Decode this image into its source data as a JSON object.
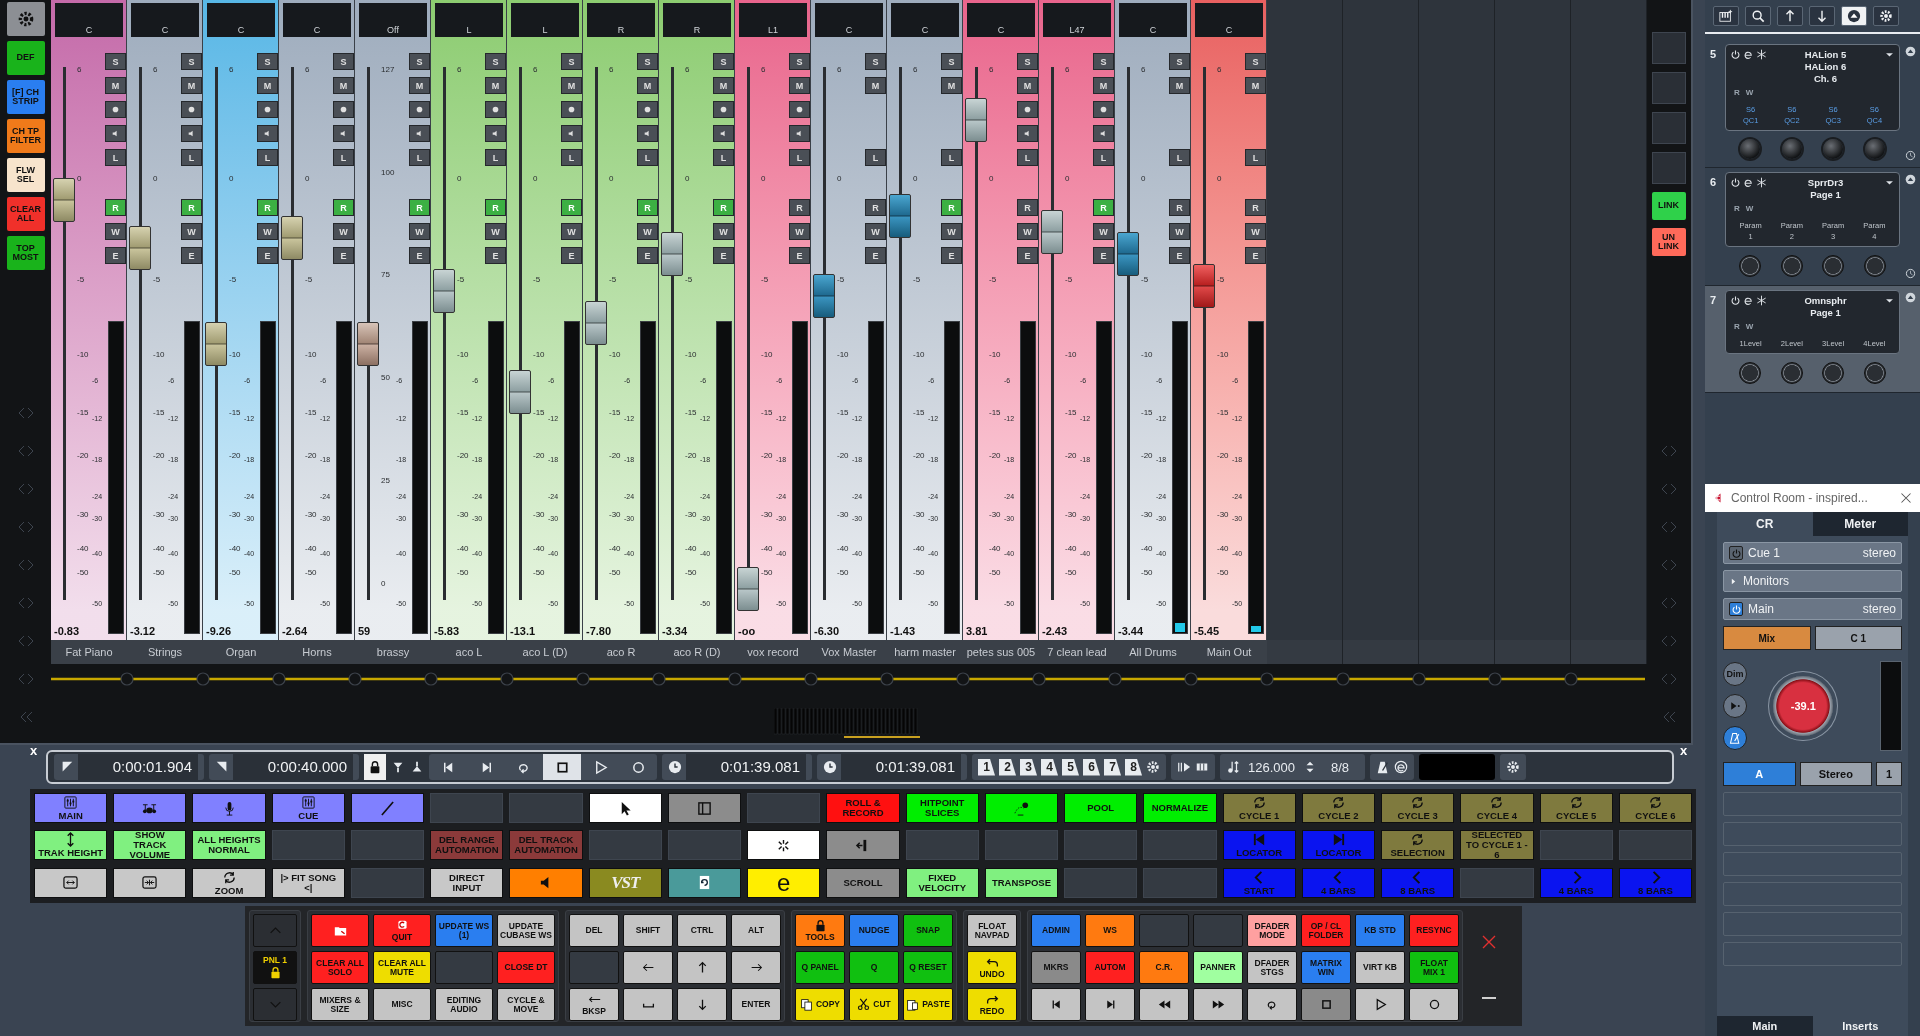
{
  "mixer": {
    "sidebar": [
      {
        "kind": "gear",
        "color": "#8c8f94"
      },
      {
        "kind": "text",
        "label": "DEF",
        "color": "#19b31b"
      },
      {
        "kind": "text",
        "label": "[F] CH STRIP",
        "color": "#2a7ef0"
      },
      {
        "kind": "text",
        "label": "CH TP FILTER",
        "color": "#f07a1a"
      },
      {
        "kind": "text",
        "label": "FLW SEL",
        "color": "#f7e4cc"
      },
      {
        "kind": "text",
        "label": "CLEAR ALL",
        "color": "#f0302a"
      },
      {
        "kind": "text",
        "label": "TOP MOST",
        "color": "#19b31b"
      }
    ],
    "channels": [
      {
        "name": "Fat Piano",
        "pan": "C",
        "value": "-0.83",
        "color": "#c46aa9",
        "kind": "track",
        "fader": {
          "kind": "beige",
          "level": 0.75
        },
        "read": true,
        "meter": {
          "level": 0
        },
        "buttons": [
          "S",
          "M",
          "L"
        ],
        "rwe": [
          "R",
          "W",
          "E"
        ],
        "scale": [
          "6",
          "0",
          "-5",
          "-10",
          "-15",
          "-20",
          "-30",
          "-40",
          "-50"
        ],
        "meter_scale": [
          "-6",
          "-12",
          "-18",
          "-24",
          "-30",
          "-40",
          "-50"
        ]
      },
      {
        "name": "Strings",
        "pan": "C",
        "value": "-3.12",
        "color": "#9eacbd",
        "kind": "track",
        "fader": {
          "kind": "beige",
          "level": 0.66
        },
        "read": true,
        "meter": {
          "level": 0
        },
        "buttons": [
          "S",
          "M",
          "L"
        ],
        "rwe": [
          "R",
          "W",
          "E"
        ],
        "scale": [
          "6",
          "0",
          "-5",
          "-10",
          "-15",
          "-20",
          "-30",
          "-40",
          "-50"
        ],
        "meter_scale": [
          "-6",
          "-12",
          "-18",
          "-24",
          "-30",
          "-40",
          "-50"
        ]
      },
      {
        "name": "Organ",
        "pan": "C",
        "value": "-9.26",
        "color": "#57b7e6",
        "kind": "track",
        "fader": {
          "kind": "beige",
          "level": 0.48
        },
        "read": true,
        "meter": {
          "level": 0
        },
        "buttons": [
          "S",
          "M",
          "L"
        ],
        "rwe": [
          "R",
          "W",
          "E"
        ],
        "scale": [
          "6",
          "0",
          "-5",
          "-10",
          "-15",
          "-20",
          "-30",
          "-40",
          "-50"
        ],
        "meter_scale": [
          "-6",
          "-12",
          "-18",
          "-24",
          "-30",
          "-40",
          "-50"
        ]
      },
      {
        "name": "Horns",
        "pan": "C",
        "value": "-2.64",
        "color": "#9eacbd",
        "kind": "track",
        "fader": {
          "kind": "beige",
          "level": 0.68
        },
        "read": true,
        "meter": {
          "level": 0
        },
        "buttons": [
          "S",
          "M",
          "L"
        ],
        "rwe": [
          "R",
          "W",
          "E"
        ],
        "scale": [
          "6",
          "0",
          "-5",
          "-10",
          "-15",
          "-20",
          "-30",
          "-40",
          "-50"
        ],
        "meter_scale": [
          "-6",
          "-12",
          "-18",
          "-24",
          "-30",
          "-40",
          "-50"
        ]
      },
      {
        "name": "brassy",
        "pan": "Off",
        "value": "59",
        "color": "#9eacbd",
        "kind": "track",
        "fader": {
          "kind": "brown",
          "level": 0.48
        },
        "read": true,
        "meter": {
          "level": 0
        },
        "buttons": [
          "S",
          "M",
          "L"
        ],
        "rwe": [
          "R",
          "W",
          "E"
        ],
        "scale": [
          "127",
          "100",
          "75",
          "50",
          "25",
          "0"
        ],
        "meter_scale": [
          "-6",
          "-12",
          "-18",
          "-24",
          "-30",
          "-40",
          "-50"
        ]
      },
      {
        "name": "aco L",
        "pan": "L",
        "value": "-5.83",
        "color": "#8ccc70",
        "kind": "track",
        "fader": {
          "kind": "steel",
          "level": 0.58
        },
        "read": true,
        "meter": {
          "level": 0
        },
        "buttons": [
          "S",
          "M",
          "L"
        ],
        "rwe": [
          "R",
          "W",
          "E"
        ],
        "scale": [
          "6",
          "0",
          "-5",
          "-10",
          "-15",
          "-20",
          "-30",
          "-40",
          "-50"
        ],
        "meter_scale": [
          "-6",
          "-12",
          "-18",
          "-24",
          "-30",
          "-40",
          "-50"
        ]
      },
      {
        "name": "aco L (D)",
        "pan": "L",
        "value": "-13.1",
        "color": "#8ccc70",
        "kind": "track",
        "fader": {
          "kind": "steel",
          "level": 0.39
        },
        "read": true,
        "meter": {
          "level": 0
        },
        "buttons": [
          "S",
          "M",
          "L"
        ],
        "rwe": [
          "R",
          "W",
          "E"
        ],
        "scale": [
          "6",
          "0",
          "-5",
          "-10",
          "-15",
          "-20",
          "-30",
          "-40",
          "-50"
        ],
        "meter_scale": [
          "-6",
          "-12",
          "-18",
          "-24",
          "-30",
          "-40",
          "-50"
        ]
      },
      {
        "name": "aco R",
        "pan": "R",
        "value": "-7.80",
        "color": "#8ccc70",
        "kind": "track",
        "fader": {
          "kind": "steel",
          "level": 0.52
        },
        "read": true,
        "meter": {
          "level": 0
        },
        "buttons": [
          "S",
          "M",
          "L"
        ],
        "rwe": [
          "R",
          "W",
          "E"
        ],
        "scale": [
          "6",
          "0",
          "-5",
          "-10",
          "-15",
          "-20",
          "-30",
          "-40",
          "-50"
        ],
        "meter_scale": [
          "-6",
          "-12",
          "-18",
          "-24",
          "-30",
          "-40",
          "-50"
        ]
      },
      {
        "name": "aco R (D)",
        "pan": "R",
        "value": "-3.34",
        "color": "#8ccc70",
        "kind": "track",
        "fader": {
          "kind": "steel",
          "level": 0.65
        },
        "read": true,
        "meter": {
          "level": 0
        },
        "buttons": [
          "S",
          "M",
          "L"
        ],
        "rwe": [
          "R",
          "W",
          "E"
        ],
        "scale": [
          "6",
          "0",
          "-5",
          "-10",
          "-15",
          "-20",
          "-30",
          "-40",
          "-50"
        ],
        "meter_scale": [
          "-6",
          "-12",
          "-18",
          "-24",
          "-30",
          "-40",
          "-50"
        ]
      },
      {
        "name": "vox record",
        "pan": "L1",
        "value": "-oo",
        "color": "#e8648c",
        "kind": "track",
        "fader": {
          "kind": "steel",
          "level": 0.02
        },
        "read": false,
        "meter": {
          "level": 0
        },
        "buttons": [
          "S",
          "M",
          "L"
        ],
        "rwe": [
          "R",
          "W",
          "E"
        ],
        "scale": [
          "6",
          "0",
          "-5",
          "-10",
          "-15",
          "-20",
          "-30",
          "-40",
          "-50"
        ],
        "meter_scale": [
          "-6",
          "-12",
          "-18",
          "-24",
          "-30",
          "-40",
          "-50"
        ]
      },
      {
        "name": "Vox Master",
        "pan": "C",
        "value": "-6.30",
        "color": "#9eacbd",
        "kind": "group",
        "fader": {
          "kind": "blue",
          "level": 0.57
        },
        "read": false,
        "meter": {
          "level": 0
        },
        "buttons": [
          "S",
          "M",
          "L"
        ],
        "rwe": [
          "R",
          "W",
          "E"
        ],
        "scale": [
          "6",
          "0",
          "-5",
          "-10",
          "-15",
          "-20",
          "-30",
          "-40",
          "-50"
        ],
        "meter_scale": [
          "-6",
          "-12",
          "-18",
          "-24",
          "-30",
          "-40",
          "-50"
        ]
      },
      {
        "name": "harm master",
        "pan": "C",
        "value": "-1.43",
        "color": "#9eacbd",
        "kind": "group",
        "fader": {
          "kind": "blue",
          "level": 0.72
        },
        "read": true,
        "meter": {
          "level": 0
        },
        "buttons": [
          "S",
          "M",
          "L"
        ],
        "rwe": [
          "R",
          "W",
          "E"
        ],
        "scale": [
          "6",
          "0",
          "-5",
          "-10",
          "-15",
          "-20",
          "-30",
          "-40",
          "-50"
        ],
        "meter_scale": [
          "-6",
          "-12",
          "-18",
          "-24",
          "-30",
          "-40",
          "-50"
        ]
      },
      {
        "name": "petes sus 005",
        "pan": "C",
        "value": "3.81",
        "color": "#e8648c",
        "kind": "track",
        "fader": {
          "kind": "steel",
          "level": 0.9
        },
        "read": false,
        "meter": {
          "level": 0
        },
        "buttons": [
          "S",
          "M",
          "L"
        ],
        "rwe": [
          "R",
          "W",
          "E"
        ],
        "scale": [
          "6",
          "0",
          "-5",
          "-10",
          "-15",
          "-20",
          "-30",
          "-40",
          "-50"
        ],
        "meter_scale": [
          "-6",
          "-12",
          "-18",
          "-24",
          "-30",
          "-40",
          "-50"
        ]
      },
      {
        "name": "7 clean lead",
        "pan": "L47",
        "value": "-2.43",
        "color": "#e8648c",
        "kind": "track",
        "fader": {
          "kind": "steel",
          "level": 0.69
        },
        "read": true,
        "meter": {
          "level": 0
        },
        "buttons": [
          "S",
          "M",
          "L"
        ],
        "rwe": [
          "R",
          "W",
          "E"
        ],
        "scale": [
          "6",
          "0",
          "-5",
          "-10",
          "-15",
          "-20",
          "-30",
          "-40",
          "-50"
        ],
        "meter_scale": [
          "-6",
          "-12",
          "-18",
          "-24",
          "-30",
          "-40",
          "-50"
        ]
      },
      {
        "name": "All Drums",
        "pan": "C",
        "value": "-3.44",
        "color": "#9eacbd",
        "kind": "group",
        "fader": {
          "kind": "blue",
          "level": 0.65
        },
        "read": false,
        "meter": {
          "level": 0.03
        },
        "buttons": [
          "S",
          "M",
          "L"
        ],
        "rwe": [
          "R",
          "W",
          "E"
        ],
        "scale": [
          "6",
          "0",
          "-5",
          "-10",
          "-15",
          "-20",
          "-30",
          "-40",
          "-50"
        ],
        "meter_scale": [
          "-6",
          "-12",
          "-18",
          "-24",
          "-30",
          "-40",
          "-50"
        ]
      },
      {
        "name": "Main Out",
        "pan": "C",
        "value": "-5.45",
        "color": "#e86060",
        "kind": "group",
        "fader": {
          "kind": "red",
          "level": 0.59
        },
        "read": false,
        "meter": {
          "level": 0.02
        },
        "buttons": [
          "S",
          "M",
          "L"
        ],
        "rwe": [
          "R",
          "W",
          "E"
        ],
        "scale": [
          "6",
          "0",
          "-5",
          "-10",
          "-15",
          "-20",
          "-30",
          "-40",
          "-50"
        ],
        "meter_scale": [
          "-6",
          "-12",
          "-18",
          "-24",
          "-30",
          "-40",
          "-50"
        ]
      }
    ],
    "link_buttons": [
      {
        "label": "LINK",
        "color": "#2fd14a"
      },
      {
        "label": "UN LINK",
        "color": "#ff6a5a"
      }
    ]
  },
  "transport": {
    "close_left": "x",
    "close_right": "x",
    "left_locator": "0:00:01.904",
    "right_locator": "0:00:40.000",
    "buttons": [
      {
        "kind": "tostart",
        "selected": false
      },
      {
        "kind": "toend",
        "selected": false
      },
      {
        "kind": "loop",
        "selected": false
      },
      {
        "kind": "stop",
        "selected": true
      },
      {
        "kind": "play",
        "selected": false
      },
      {
        "kind": "rec",
        "selected": false
      }
    ],
    "primary_time": "0:01:39.081",
    "secondary_time": "0:01:39.081",
    "markers": [
      "1",
      "2",
      "3",
      "4",
      "5",
      "6",
      "7",
      "8"
    ],
    "tempo": "126.000",
    "signature": "8/8"
  },
  "pads": [
    [
      {
        "kind": "mixer",
        "label": "MAIN",
        "color": "#8080ff"
      },
      {
        "kind": "drums",
        "color": "#8080ff"
      },
      {
        "kind": "mic",
        "color": "#8080ff"
      },
      {
        "kind": "mixer",
        "label": "CUE",
        "color": "#8080ff"
      },
      {
        "kind": "cable",
        "color": "#8080ff"
      },
      {
        "kind": "empty",
        "color": "#343a42"
      },
      {
        "kind": "empty",
        "color": "#343a42"
      },
      {
        "kind": "pointer",
        "color": "#ffffff"
      },
      {
        "kind": "panel",
        "color": "#8c8c8c"
      },
      {
        "kind": "empty",
        "color": "#343a42"
      },
      {
        "kind": "text",
        "label": "ROLL & RECORD",
        "color": "#ff1010"
      },
      {
        "kind": "text",
        "label": "HITPOINT SLICES",
        "color": "#00ee00"
      },
      {
        "kind": "jump",
        "color": "#00ee00"
      },
      {
        "kind": "text",
        "label": "POOL",
        "color": "#00ee00"
      },
      {
        "kind": "text",
        "label": "NORMALIZE",
        "color": "#00ee00"
      },
      {
        "kind": "cycle",
        "label": "CYCLE 1",
        "color": "#7f7a3e"
      },
      {
        "kind": "cycle",
        "label": "CYCLE 2",
        "color": "#7f7a3e"
      },
      {
        "kind": "cycle",
        "label": "CYCLE 3",
        "color": "#7f7a3e"
      },
      {
        "kind": "cycle",
        "label": "CYCLE 4",
        "color": "#7f7a3e"
      },
      {
        "kind": "cycle",
        "label": "CYCLE 5",
        "color": "#7f7a3e"
      },
      {
        "kind": "cycle",
        "label": "CYCLE 6",
        "color": "#7f7a3e"
      }
    ],
    [
      {
        "kind": "height",
        "label": "TRAK HEIGHT",
        "color": "#80f080"
      },
      {
        "kind": "text",
        "label": "SHOW TRACK VOLUME",
        "color": "#80f080"
      },
      {
        "kind": "text",
        "label": "ALL HEIGHTS NORMAL",
        "color": "#80f080"
      },
      {
        "kind": "empty",
        "color": "#343a42"
      },
      {
        "kind": "empty",
        "color": "#343a42"
      },
      {
        "kind": "text",
        "label": "DEL RANGE AUTOMATION",
        "color": "#8b3a3a"
      },
      {
        "kind": "text",
        "label": "DEL TRACK AUTOMATION",
        "color": "#8b3a3a"
      },
      {
        "kind": "empty",
        "color": "#343a42"
      },
      {
        "kind": "empty",
        "color": "#343a42"
      },
      {
        "kind": "burst",
        "color": "#ffffff"
      },
      {
        "kind": "insert",
        "color": "#8c8c8c"
      },
      {
        "kind": "empty",
        "color": "#343a42"
      },
      {
        "kind": "empty",
        "color": "#343a42"
      },
      {
        "kind": "empty",
        "color": "#343a42"
      },
      {
        "kind": "empty",
        "color": "#343a42"
      },
      {
        "kind": "locstart",
        "label": "LOCATOR",
        "color": "#0a14f0"
      },
      {
        "kind": "locend",
        "label": "LOCATOR",
        "color": "#0a14f0"
      },
      {
        "kind": "cycle",
        "label": "SELECTION",
        "color": "#7f7a3e"
      },
      {
        "kind": "text",
        "label": "SELECTED TO CYCLE 1 - 6",
        "color": "#7f7a3e"
      },
      {
        "kind": "empty",
        "color": "#343a42"
      },
      {
        "kind": "empty",
        "color": "#343a42"
      }
    ],
    [
      {
        "kind": "expand",
        "color": "#c8c8c8"
      },
      {
        "kind": "shrink",
        "color": "#c8c8c8"
      },
      {
        "kind": "cycle",
        "label": "ZOOM",
        "color": "#c8c8c8"
      },
      {
        "kind": "text",
        "label": "|> FIT SONG <|",
        "color": "#c8c8c8"
      },
      {
        "kind": "empty",
        "color": "#343a42"
      },
      {
        "kind": "text",
        "label": "DIRECT INPUT",
        "color": "#c8c8c8"
      },
      {
        "kind": "speaker",
        "color": "#ff7f00"
      },
      {
        "kind": "logo",
        "label": "VST",
        "color": "#8a8a20"
      },
      {
        "kind": "reload",
        "color": "#4a9a9a"
      },
      {
        "kind": "letter",
        "label": "e",
        "color": "#ffee00"
      },
      {
        "kind": "text",
        "label": "SCROLL",
        "color": "#8c8c8c"
      },
      {
        "kind": "text",
        "label": "FIXED VELOCITY",
        "color": "#80f080"
      },
      {
        "kind": "text",
        "label": "TRANSPOSE",
        "color": "#80f080"
      },
      {
        "kind": "empty",
        "color": "#343a42"
      },
      {
        "kind": "empty",
        "color": "#343a42"
      },
      {
        "kind": "left",
        "label": "START",
        "color": "#0a14f0"
      },
      {
        "kind": "left",
        "label": "4 BARS",
        "color": "#0a14f0"
      },
      {
        "kind": "left",
        "label": "8 BARS",
        "color": "#0a14f0"
      },
      {
        "kind": "empty",
        "color": "#343a42"
      },
      {
        "kind": "right",
        "label": "4 BARS",
        "color": "#0a14f0"
      },
      {
        "kind": "right",
        "label": "8 BARS",
        "color": "#0a14f0"
      }
    ]
  ],
  "keypad": [
    {
      "keys": [
        {
          "kind": "up",
          "color": "#2b2e33"
        },
        {
          "kind": "lock",
          "label": "PNL 1",
          "color": "#111111"
        },
        {
          "kind": "down",
          "color": "#2b2e33"
        }
      ]
    },
    {
      "keys": [
        {
          "kind": "folder",
          "color": "#ff2020"
        },
        {
          "kind": "quit",
          "label": "QUIT",
          "color": "#ff2020"
        },
        {
          "kind": "text",
          "label": "UPDATE WS (1)",
          "color": "#2a7ef0"
        },
        {
          "kind": "text",
          "label": "UPDATE CUBASE WS",
          "color": "#c4c4c4"
        },
        {
          "kind": "text",
          "label": "CLEAR ALL SOLO",
          "color": "#ff2020"
        },
        {
          "kind": "text",
          "label": "CLEAR ALL MUTE",
          "color": "#eedd00"
        },
        {
          "kind": "empty",
          "color": "#343a42"
        },
        {
          "kind": "text",
          "label": "CLOSE DT",
          "color": "#ff2020"
        },
        {
          "kind": "text",
          "label": "MIXERS & SIZE",
          "color": "#c4c4c4"
        },
        {
          "kind": "text",
          "label": "MISC",
          "color": "#c4c4c4"
        },
        {
          "kind": "text",
          "label": "EDITING AUDIO",
          "color": "#c4c4c4"
        },
        {
          "kind": "text",
          "label": "CYCLE & MOVE",
          "color": "#c4c4c4"
        }
      ]
    },
    {
      "keys": [
        {
          "kind": "text",
          "label": "DEL",
          "color": "#c4c4c4"
        },
        {
          "kind": "text",
          "label": "SHIFT",
          "color": "#c4c4c4"
        },
        {
          "kind": "text",
          "label": "CTRL",
          "color": "#c4c4c4"
        },
        {
          "kind": "text",
          "label": "ALT",
          "color": "#c4c4c4"
        },
        {
          "kind": "empty",
          "color": "#343a42"
        },
        {
          "kind": "arrleft",
          "color": "#c4c4c4"
        },
        {
          "kind": "arrup",
          "color": "#c4c4c4"
        },
        {
          "kind": "arrright",
          "color": "#c4c4c4"
        },
        {
          "kind": "bksp",
          "label": "BKSP",
          "color": "#c4c4c4"
        },
        {
          "kind": "space",
          "color": "#c4c4c4"
        },
        {
          "kind": "arrdown",
          "color": "#c4c4c4"
        },
        {
          "kind": "text",
          "label": "ENTER",
          "color": "#c4c4c4"
        }
      ]
    },
    {
      "keys": [
        {
          "kind": "lockbelow",
          "label": "TOOLS",
          "color": "#ff7a10"
        },
        {
          "kind": "text",
          "label": "NUDGE",
          "color": "#2a7ef0"
        },
        {
          "kind": "text",
          "label": "SNAP",
          "color": "#10c010"
        },
        {
          "kind": "text",
          "label": "Q PANEL",
          "color": "#10c010"
        },
        {
          "kind": "text",
          "label": "Q",
          "color": "#10c010"
        },
        {
          "kind": "text",
          "label": "Q RESET",
          "color": "#10c010"
        },
        {
          "kind": "copy",
          "label": "COPY",
          "color": "#eedd00"
        },
        {
          "kind": "cut",
          "label": "CUT",
          "color": "#eedd00"
        },
        {
          "kind": "paste",
          "label": "PASTE",
          "color": "#eedd00"
        }
      ]
    },
    {
      "keys": [
        {
          "kind": "text",
          "label": "FLOAT NAVPAD",
          "color": "#c4c4c4"
        },
        {
          "kind": "undo",
          "label": "UNDO",
          "color": "#eedd00"
        },
        {
          "kind": "redo",
          "label": "REDO",
          "color": "#eedd00"
        }
      ]
    },
    {
      "keys": [
        {
          "kind": "text",
          "label": "ADMIN",
          "color": "#2a7ef0"
        },
        {
          "kind": "text",
          "label": "WS",
          "color": "#ff7a10"
        },
        {
          "kind": "empty",
          "color": "#343a42"
        },
        {
          "kind": "empty",
          "color": "#343a42"
        },
        {
          "kind": "text",
          "label": "DFADER MODE",
          "color": "#ffa0a0"
        },
        {
          "kind": "text",
          "label": "OP / CL FOLDER",
          "color": "#ff2020"
        },
        {
          "kind": "text",
          "label": "KB STD",
          "color": "#2a7ef0"
        },
        {
          "kind": "text",
          "label": "RESYNC",
          "color": "#ff2020"
        },
        {
          "kind": "text",
          "label": "MKRS",
          "color": "#8a8a8a"
        },
        {
          "kind": "text",
          "label": "AUTOM",
          "color": "#ff2020"
        },
        {
          "kind": "text",
          "label": "C.R.",
          "color": "#ff7a10"
        },
        {
          "kind": "text",
          "label": "PANNER",
          "color": "#a0ffa0"
        },
        {
          "kind": "text",
          "label": "DFADER STGS",
          "color": "#c4c4c4"
        },
        {
          "kind": "text",
          "label": "MATRIX WIN",
          "color": "#2a7ef0"
        },
        {
          "kind": "text",
          "label": "VIRT KB",
          "color": "#c4c4c4"
        },
        {
          "kind": "text",
          "label": "FLOAT MIX 1",
          "color": "#10c010"
        },
        {
          "kind": "tostart",
          "color": "#c4c4c4"
        },
        {
          "kind": "toend",
          "color": "#c4c4c4"
        },
        {
          "kind": "rew",
          "color": "#c4c4c4"
        },
        {
          "kind": "ff",
          "color": "#c4c4c4"
        },
        {
          "kind": "loop",
          "color": "#c4c4c4"
        },
        {
          "kind": "stop",
          "color": "#8a8a8a"
        },
        {
          "kind": "play",
          "color": "#c4c4c4"
        },
        {
          "kind": "rec",
          "color": "#c4c4c4"
        }
      ]
    }
  ],
  "rack": {
    "toolbar": [
      {
        "kind": "keys",
        "selected": false
      },
      {
        "kind": "search",
        "selected": false
      },
      {
        "kind": "arrup",
        "selected": false
      },
      {
        "kind": "arrdown",
        "selected": false
      },
      {
        "kind": "eject",
        "selected": true
      },
      {
        "kind": "gear",
        "selected": false
      }
    ],
    "slots": [
      {
        "number": "5",
        "selected": false,
        "kind": "quick",
        "lines": [
          "HALion 5",
          "HALion 6",
          "Ch. 6"
        ],
        "rw": [
          "R",
          "W"
        ],
        "params": [
          [
            "S6",
            "QC1"
          ],
          [
            "S6",
            "QC2"
          ],
          [
            "S6",
            "QC3"
          ],
          [
            "S6",
            "QC4"
          ]
        ]
      },
      {
        "number": "6",
        "selected": false,
        "kind": "param",
        "lines": [
          "SprrDr3",
          "Page 1"
        ],
        "rw": [
          "R",
          "W"
        ],
        "params": [
          [
            "Param",
            "1"
          ],
          [
            "Param",
            "2"
          ],
          [
            "Param",
            "3"
          ],
          [
            "Param",
            "4"
          ]
        ]
      },
      {
        "number": "7",
        "selected": true,
        "kind": "param",
        "lines": [
          "Omnsphr",
          "Page 1"
        ],
        "rw": [
          "R",
          "W"
        ],
        "params": [
          [
            "1Level"
          ],
          [
            "2Level"
          ],
          [
            "3Level"
          ],
          [
            "4Level"
          ]
        ]
      }
    ]
  },
  "control_room": {
    "title": "Control Room - inspired...",
    "tabs": [
      {
        "label": "CR",
        "selected": true
      },
      {
        "label": "Meter",
        "selected": false
      }
    ],
    "rows": [
      {
        "kind": "channel",
        "label": "Cue 1",
        "format": "stereo",
        "on": false
      },
      {
        "kind": "folder",
        "label": "Monitors"
      },
      {
        "kind": "channel",
        "label": "Main",
        "format": "stereo",
        "on": true
      }
    ],
    "sources": [
      {
        "label": "Mix",
        "selected": true
      },
      {
        "label": "C 1",
        "selected": false
      }
    ],
    "side_buttons": [
      {
        "kind": "dim",
        "label": "Dim",
        "on": false
      },
      {
        "kind": "talk",
        "on": false
      },
      {
        "kind": "click",
        "on": true
      }
    ],
    "volume": "-39.1",
    "outputs": [
      {
        "label": "A",
        "selected": true
      },
      {
        "label": "Stereo",
        "selected": false
      },
      {
        "label": "1",
        "selected": false
      }
    ],
    "bottom_tabs": [
      {
        "label": "Main",
        "selected": true
      },
      {
        "label": "Inserts",
        "selected": false
      }
    ]
  }
}
